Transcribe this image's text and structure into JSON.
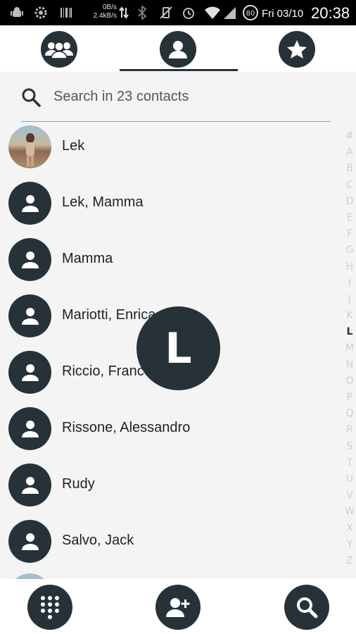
{
  "status_bar": {
    "rate_up": "0B/s",
    "rate_down": "2.4kB/s",
    "battery_level": "80",
    "date": "Fri 03/10",
    "time": "20:38"
  },
  "tabs": [
    {
      "name": "groups",
      "icon": "groups-icon",
      "selected": false
    },
    {
      "name": "contacts",
      "icon": "person-icon",
      "selected": true
    },
    {
      "name": "favorites",
      "icon": "star-icon",
      "selected": false
    }
  ],
  "search": {
    "placeholder": "Search in 23 contacts",
    "value": ""
  },
  "contacts": [
    {
      "name": "Lek",
      "has_photo": true
    },
    {
      "name": "Lek, Mamma",
      "has_photo": false
    },
    {
      "name": "Mamma",
      "has_photo": false
    },
    {
      "name": "Mariotti, Enrica",
      "has_photo": false
    },
    {
      "name": "Riccio, Franco",
      "has_photo": false
    },
    {
      "name": "Rissone, Alessandro",
      "has_photo": false
    },
    {
      "name": "Rudy",
      "has_photo": false
    },
    {
      "name": "Salvo, Jack",
      "has_photo": false
    }
  ],
  "alphabet_index": [
    "#",
    "A",
    "B",
    "C",
    "D",
    "E",
    "F",
    "G",
    "H",
    "I",
    "J",
    "K",
    "L",
    "M",
    "N",
    "O",
    "P",
    "Q",
    "R",
    "S",
    "T",
    "U",
    "V",
    "W",
    "X",
    "Y",
    "Z"
  ],
  "index_active": "L",
  "letter_bubble": "L",
  "bottom_actions": [
    {
      "name": "dialpad",
      "icon": "dialpad-icon"
    },
    {
      "name": "add-contact",
      "icon": "add-person-icon"
    },
    {
      "name": "search",
      "icon": "search-icon"
    }
  ],
  "colors": {
    "accent": "#263238",
    "background": "#f4f4f4",
    "status_bar": "#000000"
  }
}
